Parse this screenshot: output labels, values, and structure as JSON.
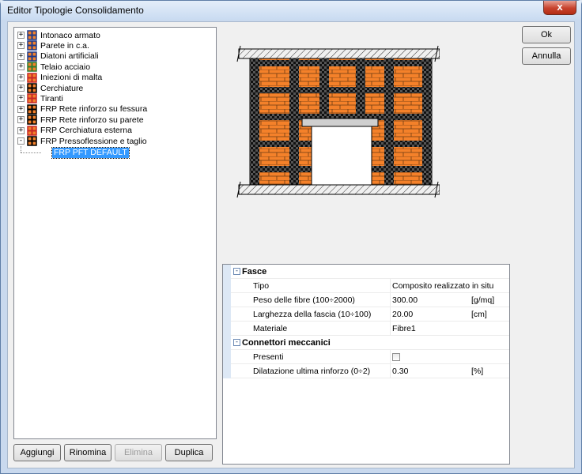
{
  "window": {
    "title": "Editor Tipologie Consolidamento",
    "close_label": "x"
  },
  "tree": {
    "items": [
      {
        "label": "Intonaco armato",
        "icon": "intonaco-icon",
        "expander": "+"
      },
      {
        "label": "Parete in c.a.",
        "icon": "parete-icon",
        "expander": "+"
      },
      {
        "label": "Diatoni artificiali",
        "icon": "diatoni-icon",
        "expander": "+"
      },
      {
        "label": "Telaio acciaio",
        "icon": "telaio-icon",
        "expander": "+"
      },
      {
        "label": "Iniezioni di malta",
        "icon": "iniezioni-icon",
        "expander": "+"
      },
      {
        "label": "Cerchiature",
        "icon": "cerchiature-icon",
        "expander": "+"
      },
      {
        "label": "Tiranti",
        "icon": "tiranti-icon",
        "expander": "+"
      },
      {
        "label": "FRP Rete rinforzo su fessura",
        "icon": "frp-fessura-icon",
        "expander": "+"
      },
      {
        "label": "FRP Rete rinforzo su parete",
        "icon": "frp-parete-icon",
        "expander": "+"
      },
      {
        "label": "FRP Cerchiatura esterna",
        "icon": "frp-cerchiatura-icon",
        "expander": "+"
      },
      {
        "label": "FRP Pressoflessione e taglio",
        "icon": "frp-pressoflessione-icon",
        "expander": "-"
      }
    ],
    "selected_child": "FRP PFT DEFAULT"
  },
  "buttons": {
    "aggiungi": "Aggiungi",
    "rinomina": "Rinomina",
    "elimina": "Elimina",
    "duplica": "Duplica",
    "ok": "Ok",
    "annulla": "Annulla"
  },
  "properties": {
    "fasce": {
      "category": "Fasce",
      "toggle": "-",
      "rows": [
        {
          "name": "Tipo",
          "value": "Composito realizzato in situ",
          "unit": ""
        },
        {
          "name": "Peso delle fibre (100÷2000)",
          "value": "300.00",
          "unit": "[g/mq]"
        },
        {
          "name": "Larghezza della fascia (10÷100)",
          "value": "20.00",
          "unit": "[cm]"
        },
        {
          "name": "Materiale",
          "value": "Fibre1",
          "unit": ""
        }
      ]
    },
    "connettori": {
      "category": "Connettori meccanici",
      "toggle": "-",
      "rows": [
        {
          "name": "Presenti",
          "value": "",
          "unit": "",
          "checked": false
        },
        {
          "name": "Dilatazione ultima rinforzo (0÷2)",
          "value": "0.30",
          "unit": "[%]"
        }
      ]
    }
  },
  "colors": {
    "brick": "#f4812a",
    "fiber": "#1a1a1a",
    "selection": "#3399ff"
  }
}
